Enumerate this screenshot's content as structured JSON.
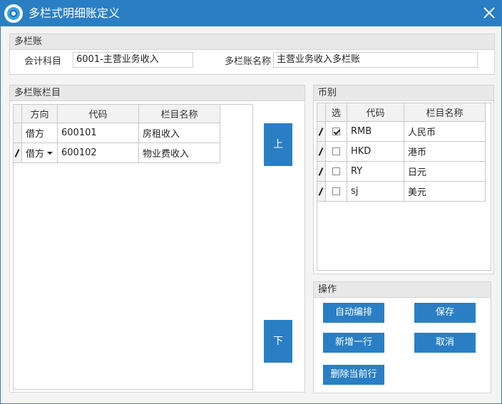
{
  "window": {
    "title": "多栏式明细账定义"
  },
  "ledger": {
    "section_label": "多栏账",
    "account_label": "会计科目",
    "account_value": "6001-主营业务收入",
    "name_label": "多栏账名称",
    "name_value": "主营业务收入多栏账"
  },
  "columns_section": {
    "label": "多栏账栏目",
    "headers": [
      "方向",
      "代码",
      "栏目名称"
    ],
    "rows": [
      {
        "direction": "借方",
        "code": "600101",
        "name": "房租收入"
      },
      {
        "direction": "借方",
        "code": "600102",
        "name": "物业费收入"
      }
    ],
    "up_label": "上",
    "down_label": "下"
  },
  "currency_section": {
    "label": "币别",
    "headers": [
      "选",
      "代码",
      "栏目名称"
    ],
    "rows": [
      {
        "checked": true,
        "code": "RMB",
        "name": "人民币"
      },
      {
        "checked": false,
        "code": "HKD",
        "name": "港币"
      },
      {
        "checked": false,
        "code": "RY",
        "name": "日元"
      },
      {
        "checked": false,
        "code": "sj",
        "name": "美元"
      }
    ]
  },
  "operations": {
    "label": "操作",
    "auto_arrange": "自动编排",
    "save": "保存",
    "add_row": "新增一行",
    "cancel": "取消",
    "delete_row": "删除当前行"
  },
  "colors": {
    "accent": "#2a7fc4",
    "header_bg": "#e8e8e8"
  }
}
